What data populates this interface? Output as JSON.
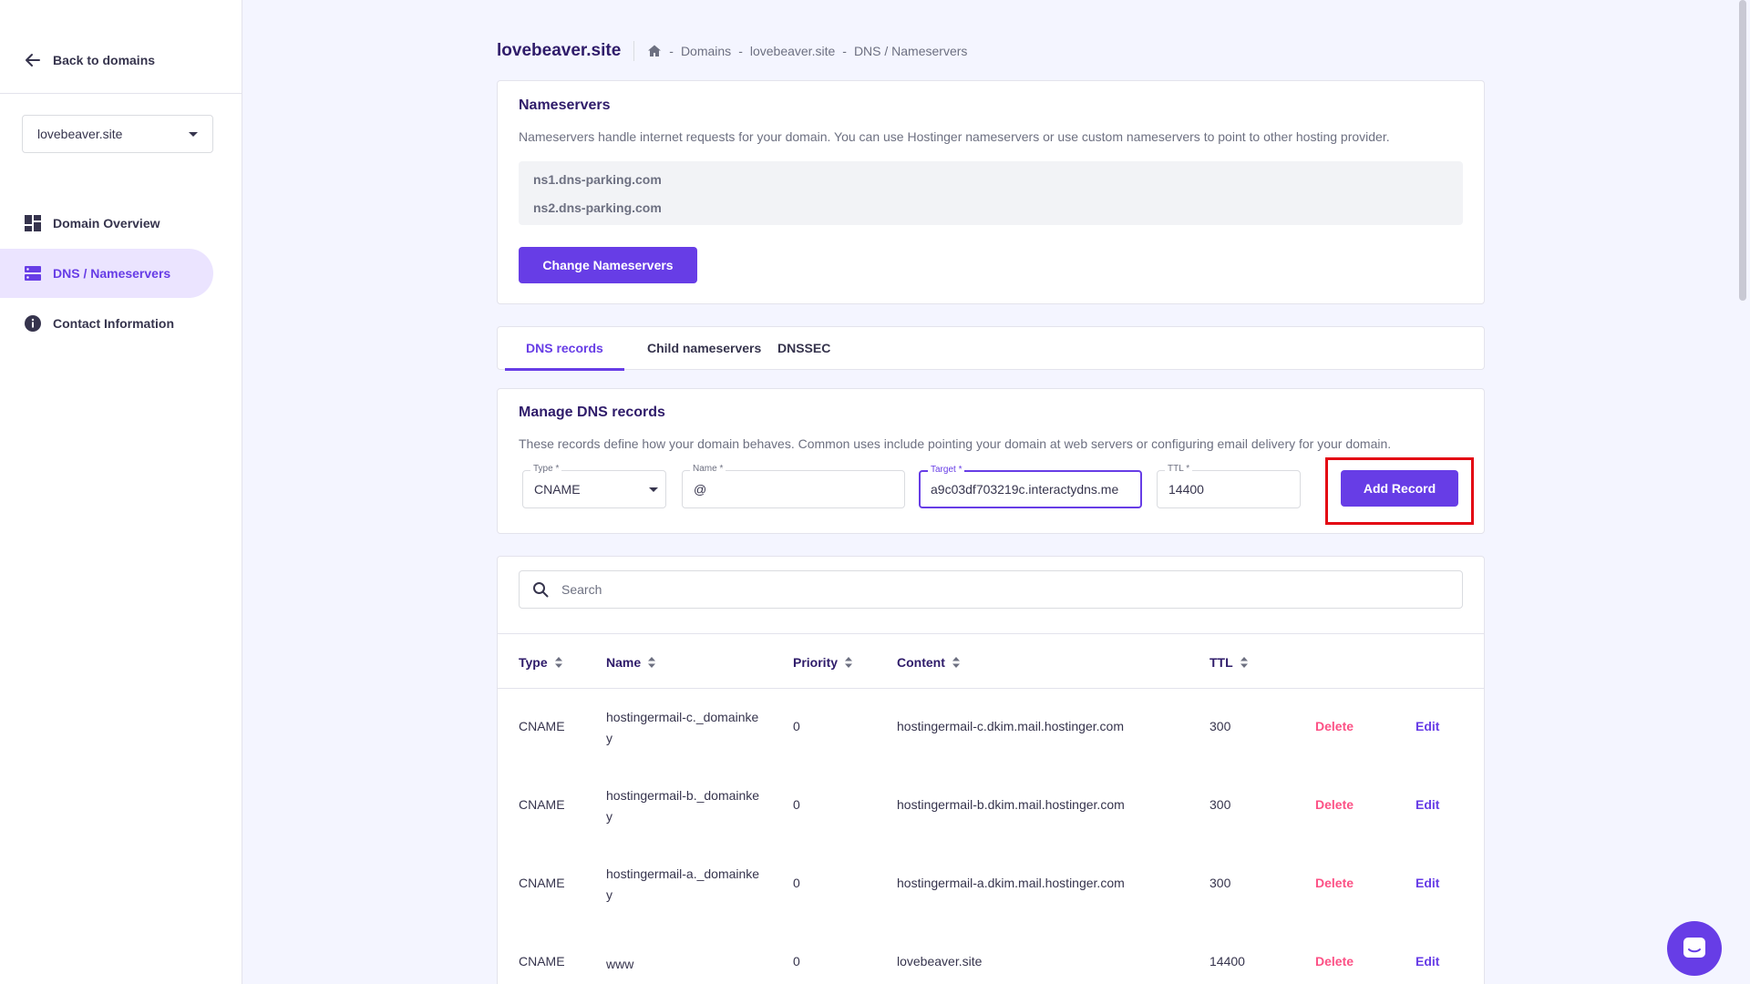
{
  "sidebar": {
    "back_label": "Back to domains",
    "domain_selected": "lovebeaver.site",
    "items": [
      {
        "label": "Domain Overview",
        "icon": "dashboard-icon"
      },
      {
        "label": "DNS / Nameservers",
        "icon": "server-icon",
        "active": true
      },
      {
        "label": "Contact Information",
        "icon": "info-icon"
      }
    ]
  },
  "header": {
    "title": "lovebeaver.site",
    "breadcrumb": [
      "Domains",
      "lovebeaver.site",
      "DNS / Nameservers"
    ],
    "separator": "-"
  },
  "nameservers": {
    "title": "Nameservers",
    "description": "Nameservers handle internet requests for your domain. You can use Hostinger nameservers or use custom nameservers to point to other hosting provider.",
    "servers": [
      "ns1.dns-parking.com",
      "ns2.dns-parking.com"
    ],
    "button_label": "Change Nameservers"
  },
  "tabs": [
    {
      "label": "DNS records",
      "active": true
    },
    {
      "label": "Child nameservers"
    },
    {
      "label": "DNSSEC"
    }
  ],
  "manage": {
    "title": "Manage DNS records",
    "description": "These records define how your domain behaves. Common uses include pointing your domain at web servers or configuring email delivery for your domain.",
    "type_label": "Type",
    "type_value": "CNAME",
    "name_label": "Name",
    "name_value": "@",
    "target_label": "Target",
    "target_value": "a9c03df703219c.interactydns.me",
    "ttl_label": "TTL",
    "ttl_value": "14400",
    "required_mark": "*",
    "add_button": "Add Record"
  },
  "table": {
    "search_placeholder": "Search",
    "columns": [
      "Type",
      "Name",
      "Priority",
      "Content",
      "TTL"
    ],
    "delete_label": "Delete",
    "edit_label": "Edit",
    "rows": [
      {
        "type": "CNAME",
        "name": "hostingermail-c._domainkey",
        "priority": "0",
        "content": "hostingermail-c.dkim.mail.hostinger.com",
        "ttl": "300"
      },
      {
        "type": "CNAME",
        "name": "hostingermail-b._domainkey",
        "priority": "0",
        "content": "hostingermail-b.dkim.mail.hostinger.com",
        "ttl": "300"
      },
      {
        "type": "CNAME",
        "name": "hostingermail-a._domainkey",
        "priority": "0",
        "content": "hostingermail-a.dkim.mail.hostinger.com",
        "ttl": "300"
      },
      {
        "type": "CNAME",
        "name": "www",
        "priority": "0",
        "content": "lovebeaver.site",
        "ttl": "14400"
      }
    ]
  },
  "colors": {
    "accent": "#673de6",
    "danger": "#fc5185",
    "highlight_frame": "#e30613"
  }
}
